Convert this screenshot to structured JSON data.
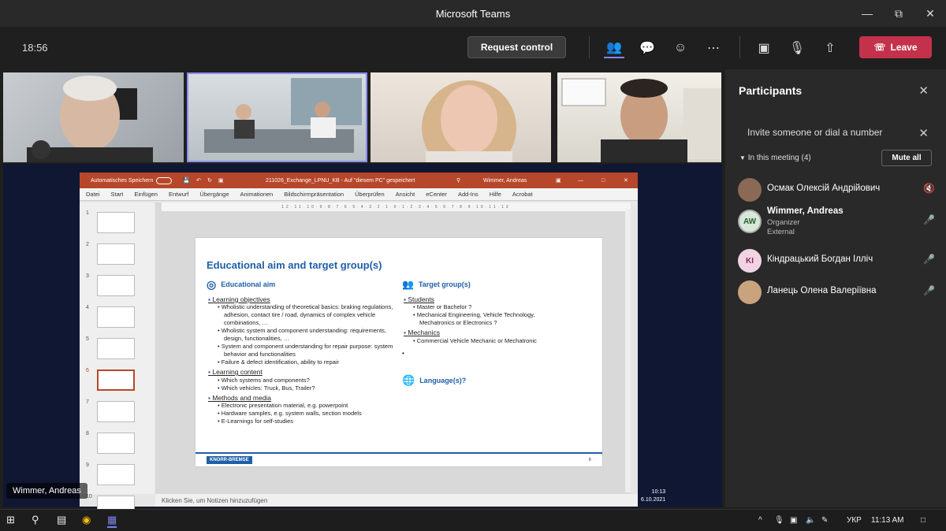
{
  "window": {
    "title": "Microsoft Teams"
  },
  "callbar": {
    "clock": "18:56",
    "request_control": "Request control",
    "leave": "Leave"
  },
  "presenter": {
    "name": "Wimmer, Andreas"
  },
  "ppt": {
    "autosave": "Automatisches Speichern",
    "filename": "211026_Exchange_LPNU_KB  -  Auf \"diesem PC\" gespeichert",
    "user": "Wimmer, Andreas",
    "menu": [
      "Datei",
      "Start",
      "Einfügen",
      "Entwurf",
      "Übergänge",
      "Animationen",
      "Bildschirmpräsentation",
      "Überprüfen",
      "Ansicht",
      "eCenter",
      "Add-Ins",
      "Hilfe",
      "Acrobat"
    ],
    "thumb_numbers": [
      "1",
      "2",
      "3",
      "4",
      "5",
      "6",
      "7",
      "8",
      "9",
      "10"
    ],
    "notes": "Klicken Sie, um Notizen hinzuzufügen",
    "time": "10:13",
    "date": "6.10.2021",
    "ruler": "12·11·10·9·8·7·6·5·4·3·2·1·0·1·2·3·4·5·6·7·8·9·10·11·12"
  },
  "slide": {
    "title": "Educational aim and target group(s)",
    "left_heading": "Educational aim",
    "right_heading": "Target group(s)",
    "language_heading": "Language(s)?",
    "left_sections": [
      {
        "label": "Learning objectives",
        "items": [
          "Wholistic understanding of theoretical basics: braking regulations, adhesion, contact tire / road, dynamics of complex vehicle combinations, …",
          "Wholistic system and component understanding: requirements, design, functionalities, …",
          "System and component understanding for repair purpose: system behavior and functionalities",
          "Failure & defect identification, ability to repair"
        ]
      },
      {
        "label": "Learning content",
        "items": [
          "Which systems and components?",
          "Which vehicles: Truck, Bus, Trailer?"
        ]
      },
      {
        "label": "Methods and media",
        "items": [
          "Electronic presentation material, e.g. powerpoint",
          "Hardware samples, e.g. system walls, section models",
          "E-Learnings for self-studies"
        ]
      }
    ],
    "right_sections": [
      {
        "label": "Students",
        "items": [
          "Master or Bachelor ?",
          "Mechanical Engineering, Vehicle Technology, Mechatronics or Electronics ?"
        ]
      },
      {
        "label": "Mechanics",
        "items": [
          "Commercial Vehicle Mechanic or Mechatronic"
        ]
      }
    ],
    "logo": "KNORR-BREMSE",
    "page": "6"
  },
  "participants": {
    "title": "Participants",
    "invite": "Invite someone or dial a number",
    "in_meeting": "In this meeting (4)",
    "mute_all": "Mute all",
    "list": [
      {
        "name": "Осмак Олексій Андрійович",
        "initials": "",
        "role": "",
        "org": "",
        "color": "#8a6a55"
      },
      {
        "name": "Wimmer, Andreas",
        "initials": "AW",
        "role": "Organizer",
        "org": "External",
        "color": "#d8e8da"
      },
      {
        "name": "Кіндрацький Богдан Ілліч",
        "initials": "KI",
        "role": "",
        "org": "",
        "color": "#f1d4e4"
      },
      {
        "name": "Ланець Олена Валеріївна",
        "initials": "",
        "role": "",
        "org": "",
        "color": "#c9a27e"
      }
    ]
  },
  "taskbar": {
    "lang": "УКР",
    "time": "11:13 AM"
  },
  "colors": {
    "leave": "#c4314b",
    "ppt_brand": "#b7472a",
    "slide_blue": "#1f5fa8"
  }
}
